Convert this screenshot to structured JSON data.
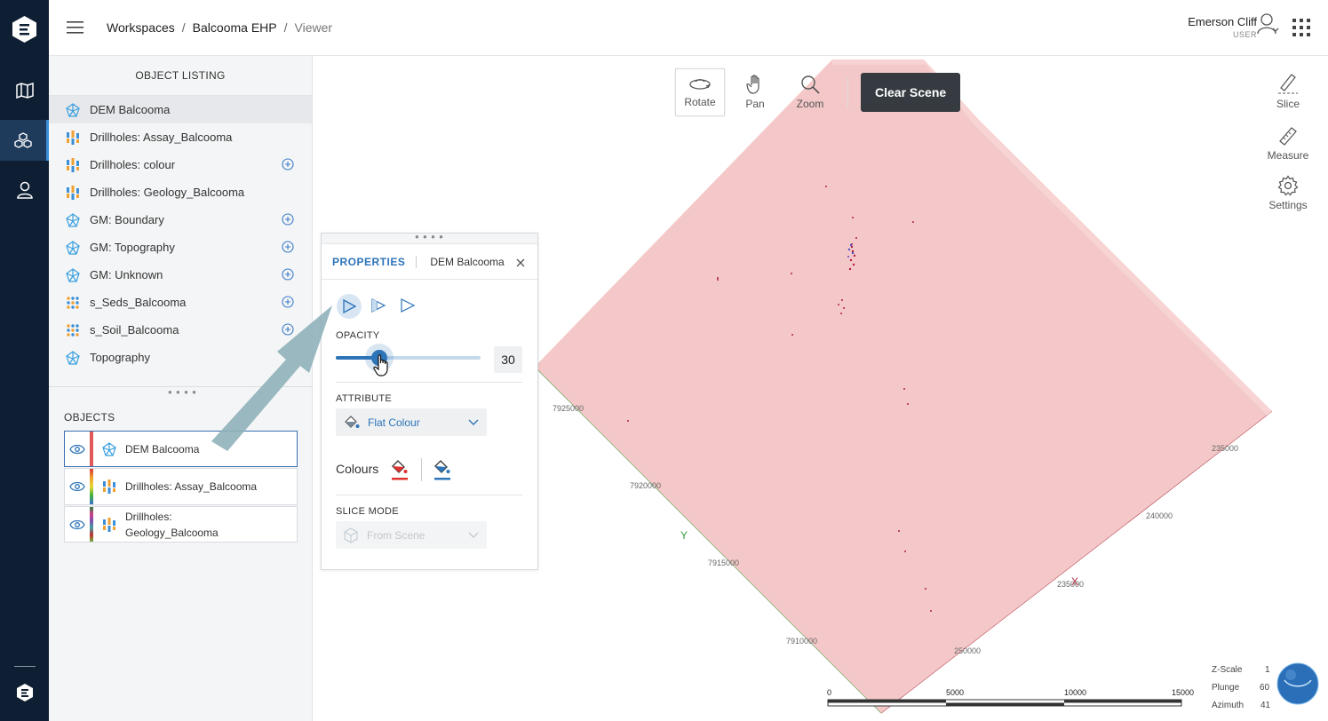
{
  "header": {
    "breadcrumb": [
      "Workspaces",
      "Balcooma EHP",
      "Viewer"
    ],
    "user_name": "Emerson Cliff",
    "user_role": "USER"
  },
  "listing": {
    "title": "OBJECT LISTING",
    "items": [
      {
        "label": "DEM Balcooma",
        "icon": "mesh-icon",
        "add": false
      },
      {
        "label": "Drillholes: Assay_Balcooma",
        "icon": "drillhole-icon",
        "add": false
      },
      {
        "label": "Drillholes: colour",
        "icon": "drillhole-icon",
        "add": true
      },
      {
        "label": "Drillholes: Geology_Balcooma",
        "icon": "drillhole-icon",
        "add": false
      },
      {
        "label": "GM: Boundary",
        "icon": "mesh-icon",
        "add": true
      },
      {
        "label": "GM: Topography",
        "icon": "mesh-icon",
        "add": true
      },
      {
        "label": "GM: Unknown",
        "icon": "mesh-icon",
        "add": true
      },
      {
        "label": "s_Seds_Balcooma",
        "icon": "points-icon",
        "add": true
      },
      {
        "label": "s_Soil_Balcooma",
        "icon": "points-icon",
        "add": true
      },
      {
        "label": "Topography",
        "icon": "mesh-icon",
        "add": false
      }
    ],
    "objects_title": "OBJECTS",
    "objects": [
      {
        "label": "DEM Balcooma"
      },
      {
        "label": "Drillholes: Assay_Balcooma"
      },
      {
        "label_line1": "Drillholes:",
        "label_line2": "Geology_Balcooma"
      }
    ]
  },
  "toolbar": {
    "rotate": "Rotate",
    "pan": "Pan",
    "zoom": "Zoom",
    "clear": "Clear Scene"
  },
  "side_tools": {
    "slice": "Slice",
    "measure": "Measure",
    "settings": "Settings"
  },
  "properties": {
    "tab": "PROPERTIES",
    "object": "DEM Balcooma",
    "opacity_label": "OPACITY",
    "opacity_value": "30",
    "opacity_fraction": 0.3,
    "attribute_label": "ATTRIBUTE",
    "attribute_value": "Flat Colour",
    "colours_label": "Colours",
    "slice_label": "SLICE MODE",
    "slice_value": "From Scene"
  },
  "scene": {
    "axis_labels": [
      "7925000",
      "7920000",
      "7915000",
      "7910000",
      "235000",
      "240000",
      "235000",
      "250000"
    ],
    "axis_x": "X",
    "axis_y": "Y",
    "scale_ticks": [
      "0",
      "5000",
      "10000",
      "15000"
    ],
    "zscale_label": "Z-Scale",
    "zscale_value": "1",
    "plunge_label": "Plunge",
    "plunge_value": "60",
    "azimuth_label": "Azimuth",
    "azimuth_value": "41",
    "surface_color": "#f4c8c8",
    "accent": "#2e74b8"
  }
}
